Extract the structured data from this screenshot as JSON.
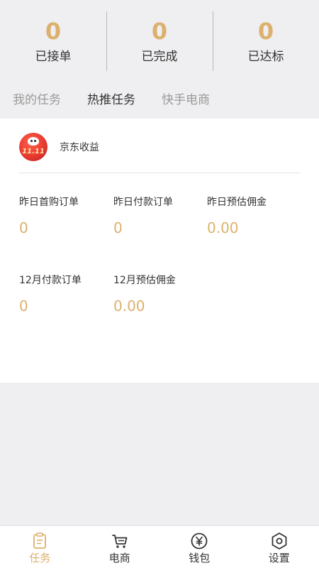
{
  "stats": [
    {
      "value": "0",
      "label": "已接单"
    },
    {
      "value": "0",
      "label": "已完成"
    },
    {
      "value": "0",
      "label": "已达标"
    }
  ],
  "tabs": [
    {
      "label": "我的任务",
      "active": false
    },
    {
      "label": "热推任务",
      "active": true
    },
    {
      "label": "快手电商",
      "active": false
    }
  ],
  "card": {
    "logo_text": "11.11",
    "title": "京东收益",
    "metrics": [
      {
        "label": "昨日首购订单",
        "value": "0"
      },
      {
        "label": "昨日付款订单",
        "value": "0"
      },
      {
        "label": "昨日预估佣金",
        "value": "0.00"
      },
      {
        "label": "12月付款订单",
        "value": "0"
      },
      {
        "label": "12月预估佣金",
        "value": "0.00"
      }
    ]
  },
  "bottom_nav": [
    {
      "label": "任务",
      "icon": "clipboard-icon",
      "active": true
    },
    {
      "label": "电商",
      "icon": "cart-icon",
      "active": false
    },
    {
      "label": "钱包",
      "icon": "yuan-coin-icon",
      "active": false
    },
    {
      "label": "设置",
      "icon": "hexagon-settings-icon",
      "active": false
    }
  ],
  "colors": {
    "accent": "#dcb16e",
    "text": "#333333",
    "muted": "#9a9a9a",
    "background": "#efeef0",
    "brand_red": "#e83a2f"
  }
}
